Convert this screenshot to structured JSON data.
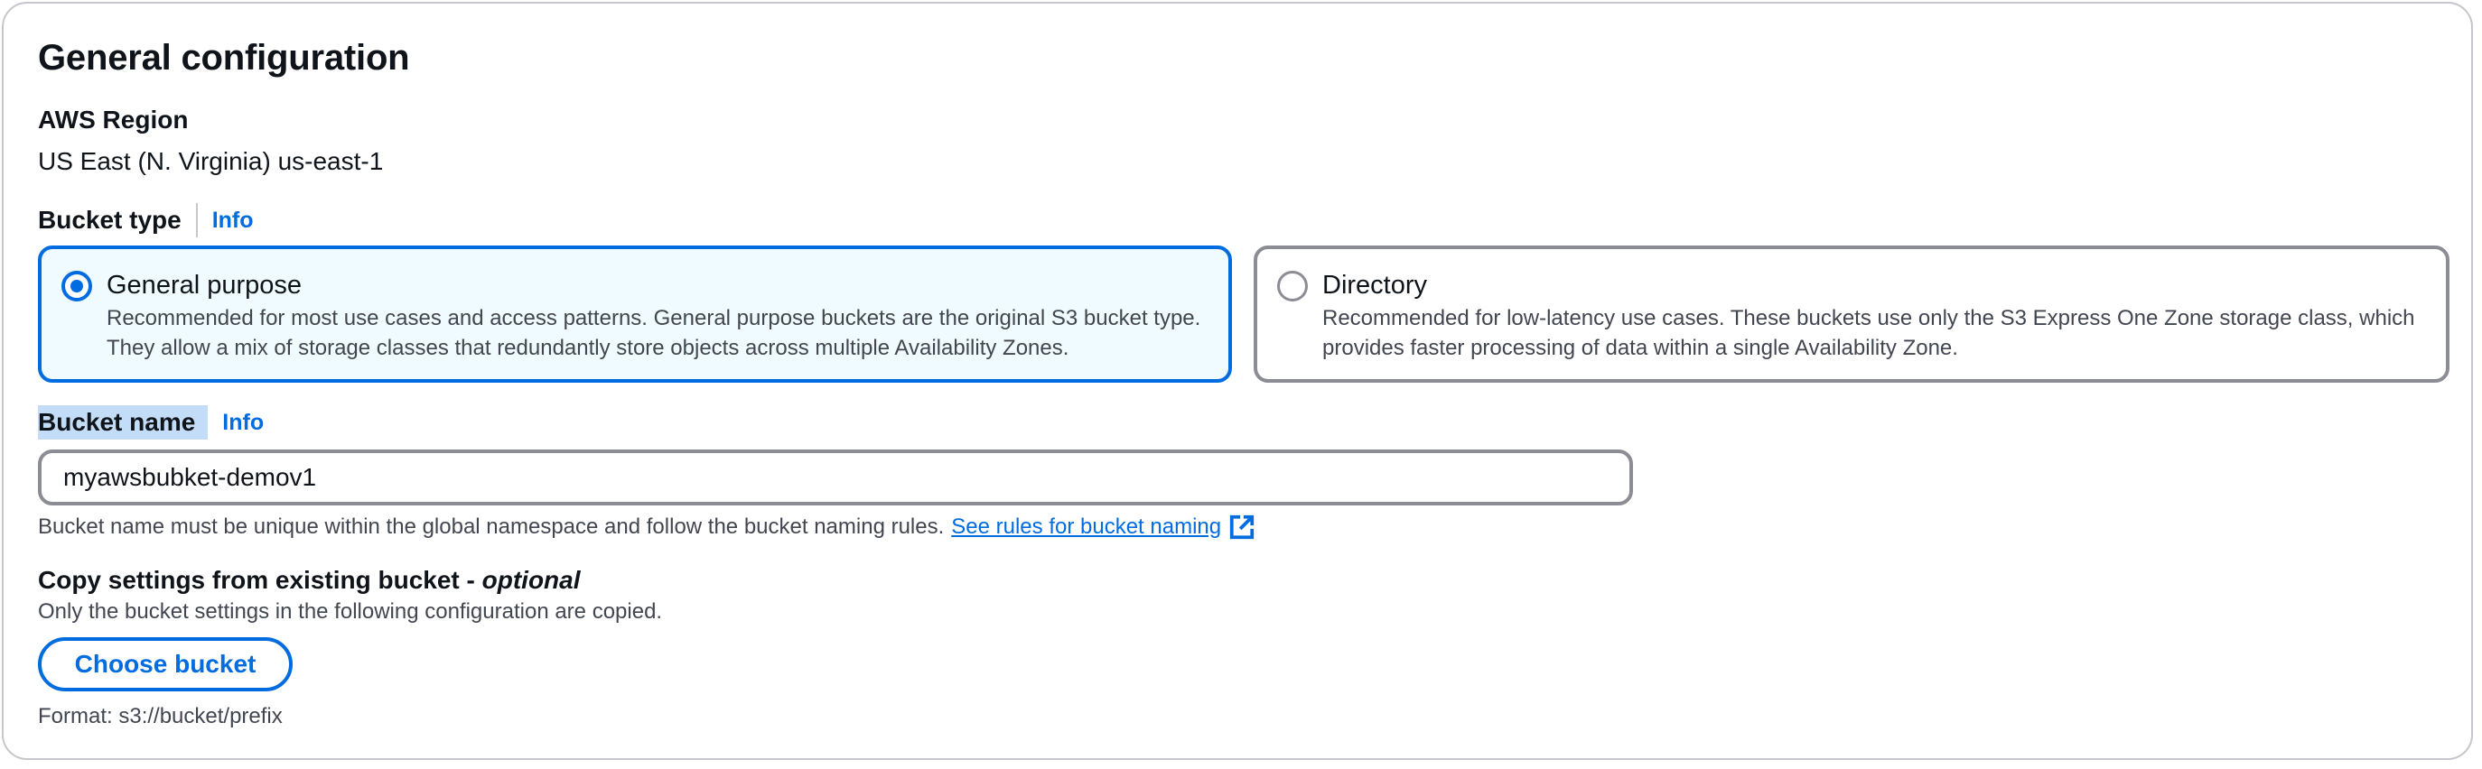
{
  "section": {
    "title": "General configuration"
  },
  "region": {
    "label": "AWS Region",
    "value": "US East (N. Virginia) us-east-1"
  },
  "bucket_type": {
    "label": "Bucket type",
    "info": "Info",
    "options": [
      {
        "title": "General purpose",
        "description": "Recommended for most use cases and access patterns. General purpose buckets are the original S3 bucket type. They allow a mix of storage classes that redundantly store objects across multiple Availability Zones.",
        "selected": true
      },
      {
        "title": "Directory",
        "description": "Recommended for low-latency use cases. These buckets use only the S3 Express One Zone storage class, which provides faster processing of data within a single Availability Zone.",
        "selected": false
      }
    ]
  },
  "bucket_name": {
    "label": "Bucket name",
    "info": "Info",
    "value": "myawsbubket-demov1",
    "hint": "Bucket name must be unique within the global namespace and follow the bucket naming rules.",
    "rules_link": "See rules for bucket naming",
    "rules_link_icon": "external-link-icon"
  },
  "copy_settings": {
    "label": "Copy settings from existing bucket - ",
    "optional": "optional",
    "description": "Only the bucket settings in the following configuration are copied.",
    "button": "Choose bucket",
    "format": "Format: s3://bucket/prefix"
  },
  "colors": {
    "accent": "#006ce0",
    "selected_tile_bg": "#f0fbff",
    "border": "#8c8c94",
    "label_highlight": "#c3dcf7"
  }
}
